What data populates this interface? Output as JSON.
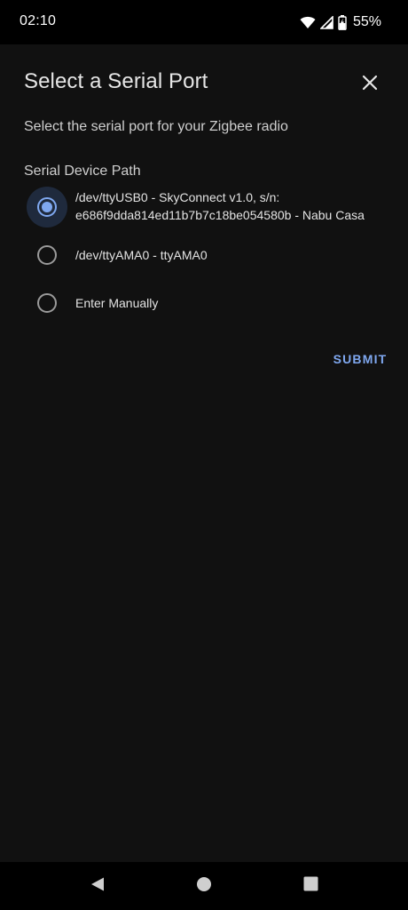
{
  "status_bar": {
    "time": "02:10",
    "battery_percent": "55%",
    "icons": [
      "wifi-icon",
      "cell-signal-icon",
      "battery-charging-icon"
    ]
  },
  "dialog": {
    "title": "Select a Serial Port",
    "description": "Select the serial port for your Zigbee radio",
    "field_label": "Serial Device Path",
    "options": [
      {
        "label": "/dev/ttyUSB0 - SkyConnect v1.0, s/n: e686f9dda814ed11b7b7c18be054580b - Nabu Casa",
        "selected": true
      },
      {
        "label": "/dev/ttyAMA0 - ttyAMA0",
        "selected": false
      },
      {
        "label": "Enter Manually",
        "selected": false
      }
    ],
    "submit_label": "SUBMIT",
    "close_icon": "close-icon"
  },
  "nav_bar": {
    "icons": [
      "back-icon",
      "home-icon",
      "recents-icon"
    ]
  },
  "colors": {
    "accent": "#7fa8f0",
    "dialog_background": "#111111",
    "system_bar": "#000000"
  }
}
